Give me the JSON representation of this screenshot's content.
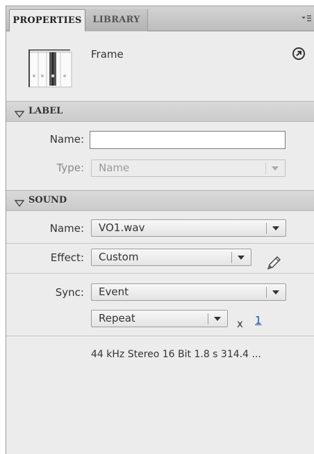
{
  "tabs": [
    {
      "label": "PROPERTIES",
      "active": true
    },
    {
      "label": "LIBRARY",
      "active": false
    }
  ],
  "header": {
    "title": "Frame",
    "thumbnail_icon": "frame-timeline-icon",
    "help_icon": "arrow-circle-icon"
  },
  "label_section": {
    "title": "LABEL",
    "name_label": "Name:",
    "name_value": "",
    "type_label": "Type:",
    "type_value": "Name"
  },
  "sound_section": {
    "title": "SOUND",
    "name_label": "Name:",
    "name_value": "VO1.wav",
    "effect_label": "Effect:",
    "effect_value": "Custom",
    "edit_icon": "pencil-icon",
    "sync_label": "Sync:",
    "sync_value": "Event",
    "repeat_value": "Repeat",
    "times_symbol": "x",
    "repeat_count": "1",
    "info": "44 kHz Stereo 16 Bit 1.8 s 314.4 ..."
  },
  "colors": {
    "panel_bg": "#ececec",
    "tab_bar": "#c4c4c4",
    "link": "#1a4fa0"
  }
}
